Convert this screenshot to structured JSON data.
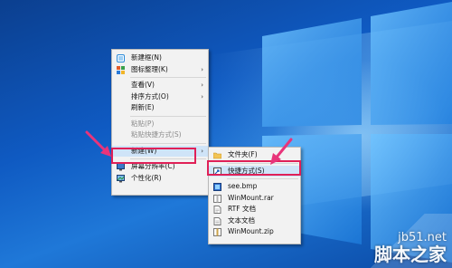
{
  "main_menu": {
    "items": [
      {
        "label": "新建框(N)",
        "icon": "new-frame-icon",
        "submenu": false,
        "disabled": false
      },
      {
        "label": "图标整理(K)",
        "icon": "arrange-icons-icon",
        "submenu": true,
        "disabled": false
      },
      {
        "label": "查看(V)",
        "icon": "",
        "submenu": true,
        "disabled": false
      },
      {
        "label": "排序方式(O)",
        "icon": "",
        "submenu": true,
        "disabled": false
      },
      {
        "label": "刷新(E)",
        "icon": "",
        "submenu": false,
        "disabled": false
      },
      {
        "label": "粘贴(P)",
        "icon": "",
        "submenu": false,
        "disabled": true
      },
      {
        "label": "粘贴快捷方式(S)",
        "icon": "",
        "submenu": false,
        "disabled": true
      },
      {
        "label": "新建(W)",
        "icon": "",
        "submenu": true,
        "disabled": false,
        "highlighted": true
      },
      {
        "label": "屏幕分辨率(C)",
        "icon": "display-icon",
        "submenu": false,
        "disabled": false
      },
      {
        "label": "个性化(R)",
        "icon": "personalize-icon",
        "submenu": false,
        "disabled": false
      }
    ]
  },
  "sub_menu": {
    "items": [
      {
        "label": "文件夹(F)",
        "icon": "folder-icon"
      },
      {
        "label": "快捷方式(S)",
        "icon": "shortcut-icon",
        "highlighted": true
      },
      {
        "label": "see.bmp",
        "icon": "bmp-file-icon"
      },
      {
        "label": "WinMount.rar",
        "icon": "rar-file-icon"
      },
      {
        "label": "RTF 文档",
        "icon": "rtf-file-icon"
      },
      {
        "label": "文本文档",
        "icon": "text-file-icon"
      },
      {
        "label": "WinMount.zip",
        "icon": "zip-file-icon"
      }
    ]
  },
  "watermark": {
    "site": "jb51.net",
    "title": "脚本之家"
  },
  "colors": {
    "highlight_border": "#e02057",
    "arrow": "#e8347a",
    "menu_highlight": "#cfe4f8"
  }
}
